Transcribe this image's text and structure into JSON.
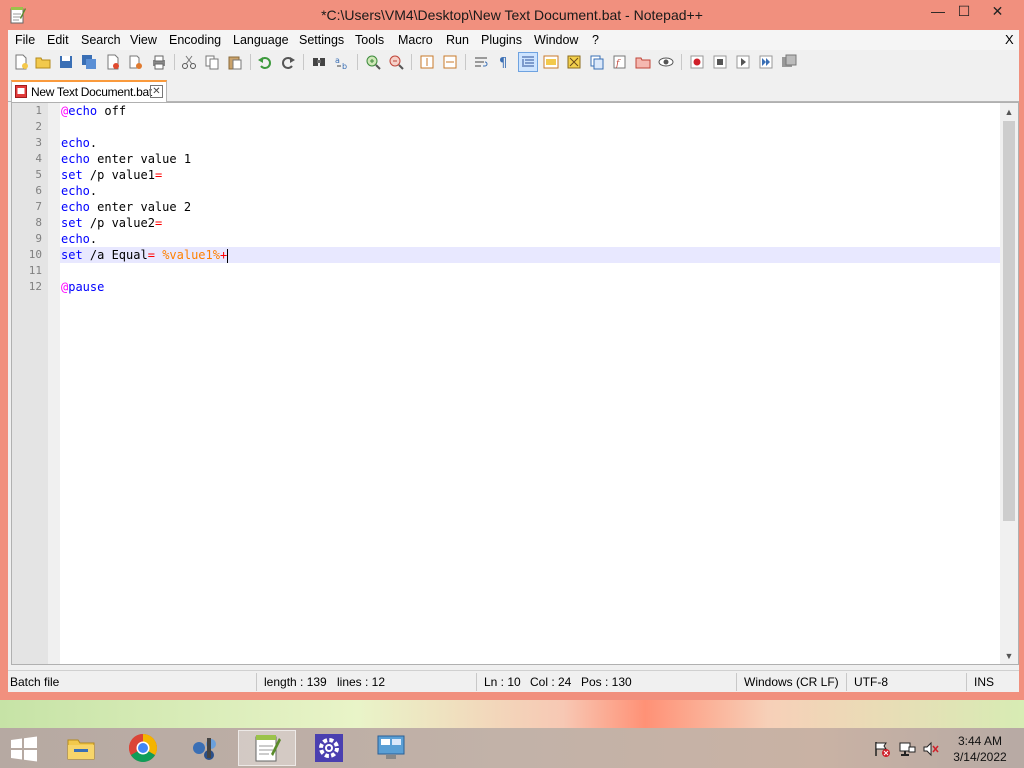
{
  "window": {
    "title": "*C:\\Users\\VM4\\Desktop\\New Text Document.bat - Notepad++",
    "minimize_glyph": "—",
    "maximize_glyph": "☐",
    "close_glyph": "✕"
  },
  "menu": {
    "items": [
      "File",
      "Edit",
      "Search",
      "View",
      "Encoding",
      "Language",
      "Settings",
      "Tools",
      "Macro",
      "Run",
      "Plugins",
      "Window",
      "?"
    ],
    "close_doc": "X"
  },
  "toolbar": {
    "icons": [
      "new-file-icon",
      "open-file-icon",
      "save-icon",
      "save-all-icon",
      "close-icon",
      "close-all-icon",
      "print-icon",
      "cut-icon",
      "copy-icon",
      "paste-icon",
      "undo-icon",
      "redo-icon",
      "find-icon",
      "replace-icon",
      "zoom-in-icon",
      "zoom-out-icon",
      "sync-vertical-icon",
      "sync-horizontal-icon",
      "word-wrap-icon",
      "show-all-chars-icon",
      "indent-guide-icon",
      "user-language-icon",
      "doc-map-icon",
      "function-list-icon",
      "folder-workspace-icon",
      "close-folder-icon",
      "monitoring-icon",
      "record-macro-icon",
      "stop-record-icon",
      "play-macro-icon",
      "run-macro-multiple-icon",
      "save-macro-icon"
    ]
  },
  "tab": {
    "label": "New Text Document.bat",
    "close_glyph": "✕"
  },
  "editor": {
    "current_line": 10,
    "lines": [
      [
        {
          "t": "@",
          "c": "at"
        },
        {
          "t": "echo",
          "c": "kw"
        },
        {
          "t": " off",
          "c": "default"
        }
      ],
      [],
      [
        {
          "t": "echo",
          "c": "kw"
        },
        {
          "t": ".",
          "c": "default"
        }
      ],
      [
        {
          "t": "echo",
          "c": "kw"
        },
        {
          "t": " enter value 1",
          "c": "default"
        }
      ],
      [
        {
          "t": "set",
          "c": "kw"
        },
        {
          "t": " /p value1",
          "c": "default"
        },
        {
          "t": "=",
          "c": "op"
        }
      ],
      [
        {
          "t": "echo",
          "c": "kw"
        },
        {
          "t": ".",
          "c": "default"
        }
      ],
      [
        {
          "t": "echo",
          "c": "kw"
        },
        {
          "t": " enter value 2",
          "c": "default"
        }
      ],
      [
        {
          "t": "set",
          "c": "kw"
        },
        {
          "t": " /p value2",
          "c": "default"
        },
        {
          "t": "=",
          "c": "op"
        }
      ],
      [
        {
          "t": "echo",
          "c": "kw"
        },
        {
          "t": ".",
          "c": "default"
        }
      ],
      [
        {
          "t": "set",
          "c": "kw"
        },
        {
          "t": " /a Equal",
          "c": "default"
        },
        {
          "t": "=",
          "c": "op"
        },
        {
          "t": " ",
          "c": "default"
        },
        {
          "t": "%value1%",
          "c": "var"
        },
        {
          "t": "+",
          "c": "op"
        },
        {
          "t": "|caret|",
          "c": "caret"
        }
      ],
      [],
      [
        {
          "t": "@",
          "c": "at"
        },
        {
          "t": "pause",
          "c": "kw"
        }
      ]
    ],
    "line_numbers": [
      "1",
      "2",
      "3",
      "4",
      "5",
      "6",
      "7",
      "8",
      "9",
      "10",
      "11",
      "12"
    ]
  },
  "statusbar": {
    "file_type": "Batch file",
    "length": "length : 139",
    "lines": "lines : 12",
    "ln": "Ln : 10",
    "col": "Col : 24",
    "pos": "Pos : 130",
    "eol": "Windows (CR LF)",
    "encoding": "UTF-8",
    "mode": "INS"
  },
  "taskbar": {
    "apps": [
      "file-explorer-icon",
      "chrome-icon",
      "network-app-icon",
      "notepadpp-icon",
      "settings-gear-icon",
      "remote-desktop-icon"
    ],
    "active_app": "notepadpp-icon",
    "tray": [
      "action-center-flag-icon",
      "network-icon",
      "volume-muted-icon"
    ],
    "time": "3:44 AM",
    "date": "3/14/2022"
  },
  "colors": {
    "keyword": "#0000ff",
    "at_symbol": "#ff00ff",
    "operator": "#ff0000",
    "variable": "#ff8000",
    "current_line": "#e8e8ff",
    "frame": "#f1907e"
  }
}
